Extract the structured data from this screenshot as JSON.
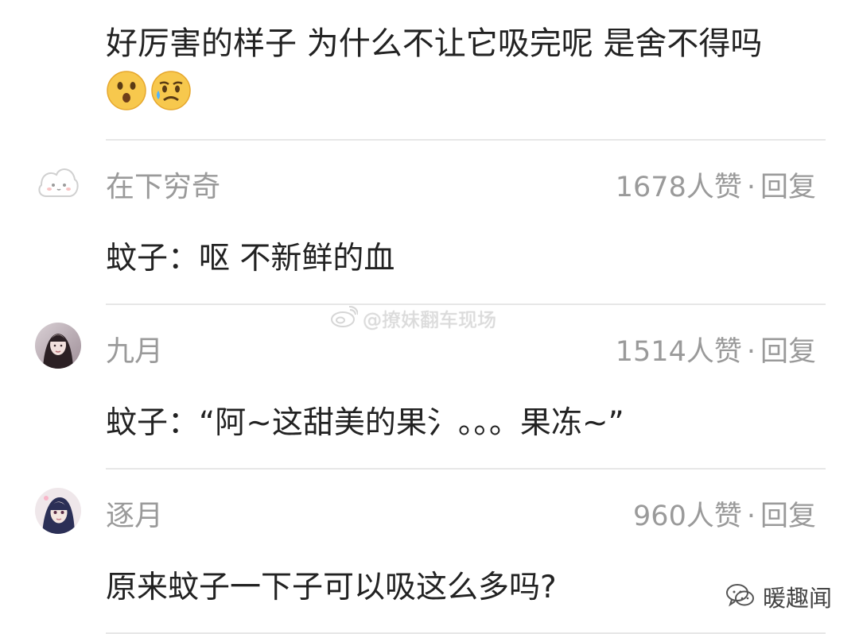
{
  "top_comment": {
    "text": "好厉害的样子 为什么不让它吸完呢 是舍不得吗",
    "emojis": [
      "surprised-face-icon",
      "sad-sweat-face-icon"
    ]
  },
  "comments": [
    {
      "username": "在下穷奇",
      "likes": "1678人赞",
      "reply_label": "回复",
      "content": "蚊子：呕 不新鲜的血",
      "avatar": "cloud-avatar"
    },
    {
      "username": "九月",
      "likes": "1514人赞",
      "reply_label": "回复",
      "content": "蚊子：“阿~这甜美的果氵。。。果冻~”",
      "avatar": "girl-avatar"
    },
    {
      "username": "逐月",
      "likes": "960人赞",
      "reply_label": "回复",
      "content": "原来蚊子一下子可以吸这么多吗?",
      "avatar": "anime-avatar"
    }
  ],
  "watermarks": {
    "weibo": "@撩妹翻车现场",
    "wechat": "暖趣闻"
  },
  "meta_separator": "·",
  "colors": {
    "text": "#222222",
    "muted": "#9a9a9a",
    "divider": "#e7e7e7"
  }
}
